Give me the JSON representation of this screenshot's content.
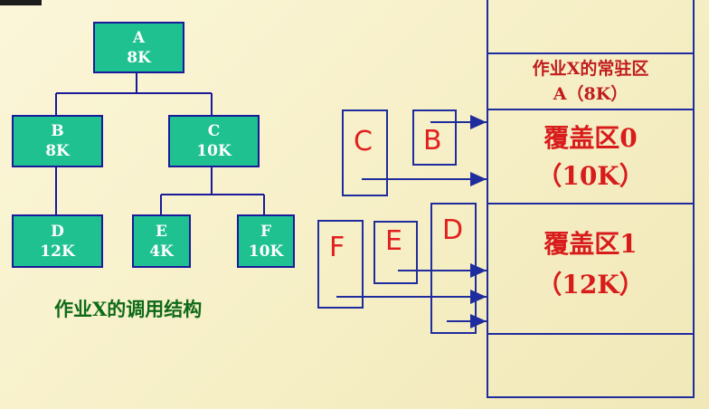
{
  "tree": {
    "A": {
      "name": "A",
      "size": "8K"
    },
    "B": {
      "name": "B",
      "size": "8K"
    },
    "C": {
      "name": "C",
      "size": "10K"
    },
    "D": {
      "name": "D",
      "size": "12K"
    },
    "E": {
      "name": "E",
      "size": "4K"
    },
    "F": {
      "name": "F",
      "size": "10K"
    },
    "caption": "作业X的调用结构"
  },
  "memory": {
    "resident_title": "作业X的常驻区",
    "resident_sub": "A（8K）",
    "overlay0_title": "覆盖区0",
    "overlay0_size": "（10K）",
    "overlay1_title": "覆盖区1",
    "overlay1_size": "（12K）"
  },
  "modules": {
    "B": "B",
    "C": "C",
    "D": "D",
    "E": "E",
    "F": "F"
  },
  "colors": {
    "node_fill": "#1fc190",
    "node_border": "#1a1a9a",
    "memory_border": "#1f2c9e",
    "label_red": "#d81c1c",
    "caption_green": "#0f6a18"
  }
}
